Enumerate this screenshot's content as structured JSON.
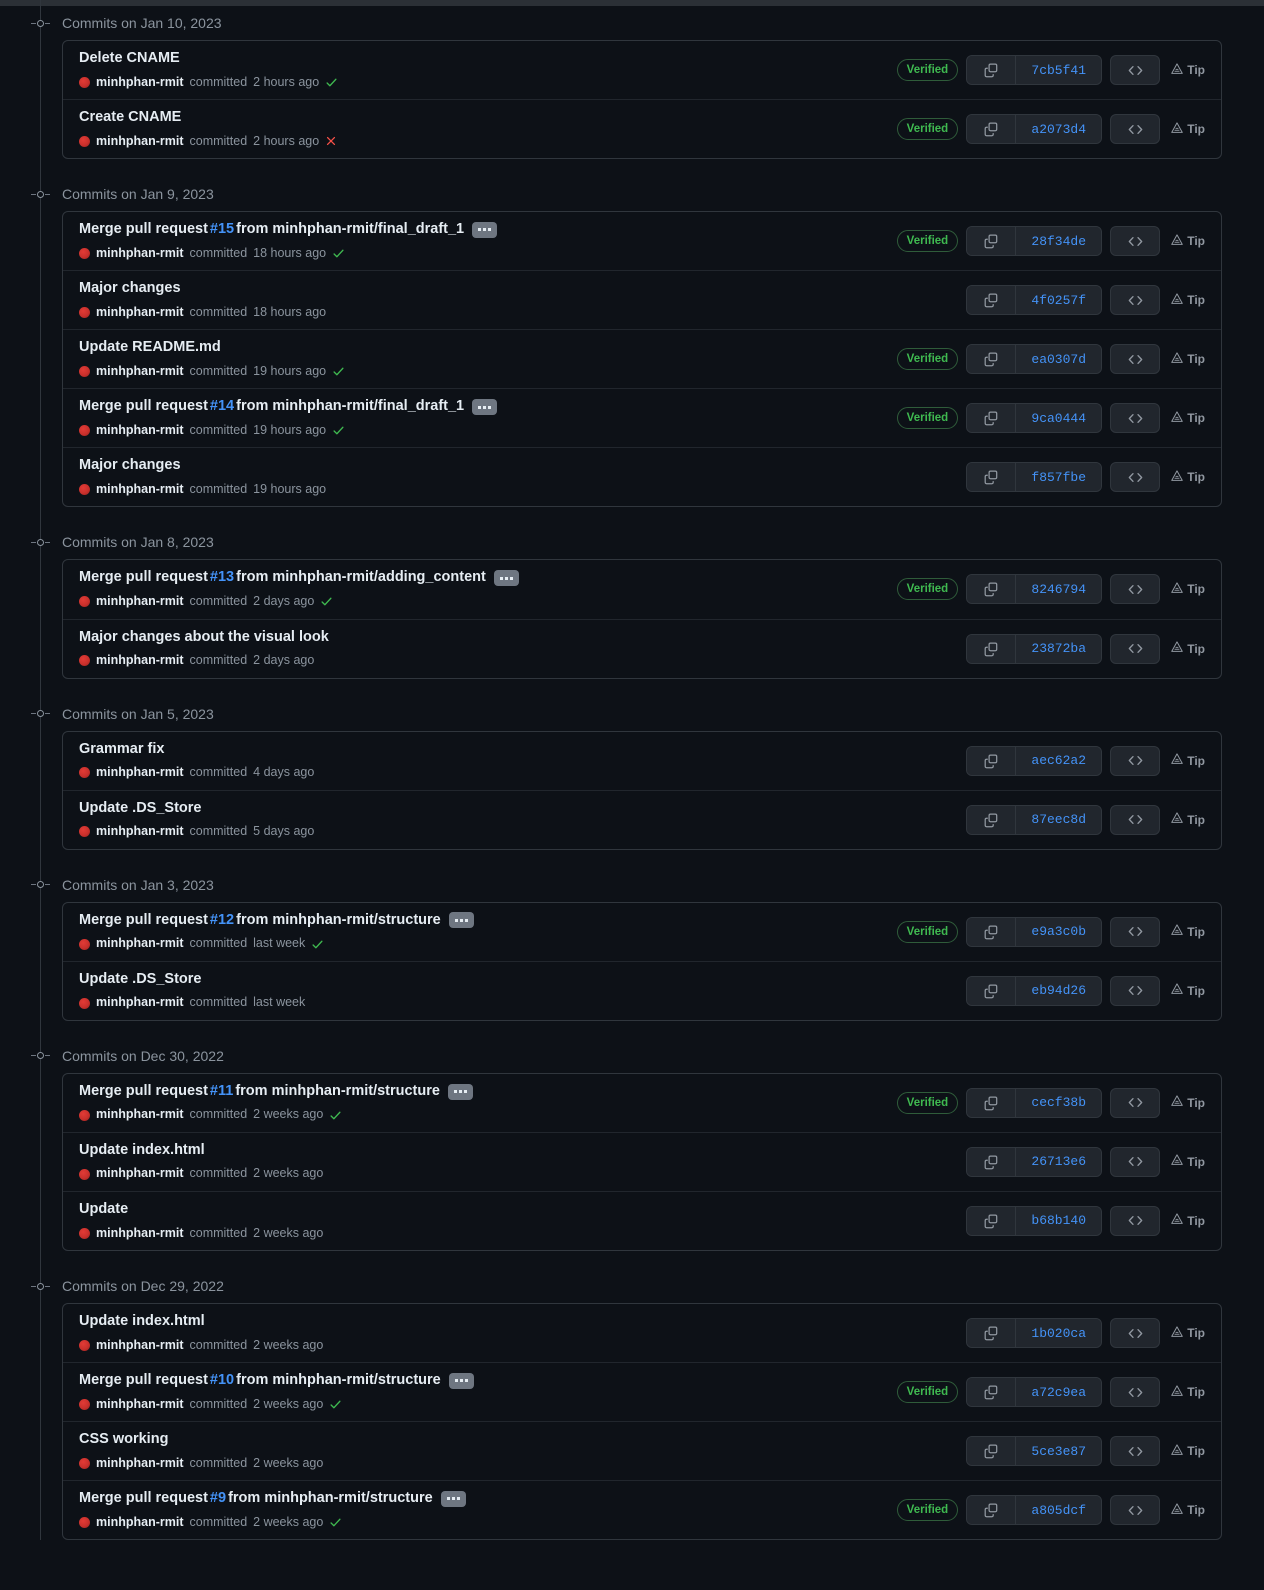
{
  "labels": {
    "verified": "Verified",
    "tip": "Tip",
    "committed": "committed",
    "expand_aria": "…"
  },
  "icons": {
    "copy": "copy-icon",
    "code": "code-icon",
    "tag": "tag-icon",
    "check": "check-icon",
    "cross": "cross-icon",
    "timeline_node": "timeline-node-icon",
    "avatar": "avatar-image"
  },
  "colors": {
    "background": "#0d1117",
    "border": "#30363d",
    "row_divider": "#21262d",
    "link": "#4493f8",
    "verified_green": "#3fb950",
    "failed_red": "#f85149",
    "muted_text": "#8b949e",
    "primary_text": "#e6edf3",
    "button_bg": "#21262d"
  },
  "author": "minhphan-rmit",
  "groups": [
    {
      "date": "Commits on Jan 10, 2023",
      "commits": [
        {
          "title_pre": "Delete CNAME",
          "pr": "",
          "title_post": "",
          "expander": false,
          "when": "2 hours ago",
          "signature": "check",
          "verified": "Verified",
          "sha": "7cb5f41"
        },
        {
          "title_pre": "Create CNAME",
          "pr": "",
          "title_post": "",
          "expander": false,
          "when": "2 hours ago",
          "signature": "cross",
          "verified": "Verified",
          "sha": "a2073d4"
        }
      ]
    },
    {
      "date": "Commits on Jan 9, 2023",
      "commits": [
        {
          "title_pre": "Merge pull request ",
          "pr": "#15",
          "title_post": " from minhphan-rmit/final_draft_1",
          "expander": true,
          "when": "18 hours ago",
          "signature": "check",
          "verified": "Verified",
          "sha": "28f34de"
        },
        {
          "title_pre": "Major changes",
          "pr": "",
          "title_post": "",
          "expander": false,
          "when": "18 hours ago",
          "signature": "none",
          "verified": "",
          "sha": "4f0257f"
        },
        {
          "title_pre": "Update README.md",
          "pr": "",
          "title_post": "",
          "expander": false,
          "when": "19 hours ago",
          "signature": "check",
          "verified": "Verified",
          "sha": "ea0307d"
        },
        {
          "title_pre": "Merge pull request ",
          "pr": "#14",
          "title_post": " from minhphan-rmit/final_draft_1",
          "expander": true,
          "when": "19 hours ago",
          "signature": "check",
          "verified": "Verified",
          "sha": "9ca0444"
        },
        {
          "title_pre": "Major changes",
          "pr": "",
          "title_post": "",
          "expander": false,
          "when": "19 hours ago",
          "signature": "none",
          "verified": "",
          "sha": "f857fbe"
        }
      ]
    },
    {
      "date": "Commits on Jan 8, 2023",
      "commits": [
        {
          "title_pre": "Merge pull request ",
          "pr": "#13",
          "title_post": " from minhphan-rmit/adding_content",
          "expander": true,
          "when": "2 days ago",
          "signature": "check",
          "verified": "Verified",
          "sha": "8246794"
        },
        {
          "title_pre": "Major changes about the visual look",
          "pr": "",
          "title_post": "",
          "expander": false,
          "when": "2 days ago",
          "signature": "none",
          "verified": "",
          "sha": "23872ba"
        }
      ]
    },
    {
      "date": "Commits on Jan 5, 2023",
      "commits": [
        {
          "title_pre": "Grammar fix",
          "pr": "",
          "title_post": "",
          "expander": false,
          "when": "4 days ago",
          "signature": "none",
          "verified": "",
          "sha": "aec62a2"
        },
        {
          "title_pre": "Update .DS_Store",
          "pr": "",
          "title_post": "",
          "expander": false,
          "when": "5 days ago",
          "signature": "none",
          "verified": "",
          "sha": "87eec8d"
        }
      ]
    },
    {
      "date": "Commits on Jan 3, 2023",
      "commits": [
        {
          "title_pre": "Merge pull request ",
          "pr": "#12",
          "title_post": " from minhphan-rmit/structure",
          "expander": true,
          "when": "last week",
          "signature": "check",
          "verified": "Verified",
          "sha": "e9a3c0b"
        },
        {
          "title_pre": "Update .DS_Store",
          "pr": "",
          "title_post": "",
          "expander": false,
          "when": "last week",
          "signature": "none",
          "verified": "",
          "sha": "eb94d26"
        }
      ]
    },
    {
      "date": "Commits on Dec 30, 2022",
      "commits": [
        {
          "title_pre": "Merge pull request ",
          "pr": "#11",
          "title_post": " from minhphan-rmit/structure",
          "expander": true,
          "when": "2 weeks ago",
          "signature": "check",
          "verified": "Verified",
          "sha": "cecf38b"
        },
        {
          "title_pre": "Update index.html",
          "pr": "",
          "title_post": "",
          "expander": false,
          "when": "2 weeks ago",
          "signature": "none",
          "verified": "",
          "sha": "26713e6"
        },
        {
          "title_pre": "Update",
          "pr": "",
          "title_post": "",
          "expander": false,
          "when": "2 weeks ago",
          "signature": "none",
          "verified": "",
          "sha": "b68b140"
        }
      ]
    },
    {
      "date": "Commits on Dec 29, 2022",
      "commits": [
        {
          "title_pre": "Update index.html",
          "pr": "",
          "title_post": "",
          "expander": false,
          "when": "2 weeks ago",
          "signature": "none",
          "verified": "",
          "sha": "1b020ca"
        },
        {
          "title_pre": "Merge pull request ",
          "pr": "#10",
          "title_post": " from minhphan-rmit/structure",
          "expander": true,
          "when": "2 weeks ago",
          "signature": "check",
          "verified": "Verified",
          "sha": "a72c9ea"
        },
        {
          "title_pre": "CSS working",
          "pr": "",
          "title_post": "",
          "expander": false,
          "when": "2 weeks ago",
          "signature": "none",
          "verified": "",
          "sha": "5ce3e87"
        },
        {
          "title_pre": "Merge pull request ",
          "pr": "#9",
          "title_post": " from minhphan-rmit/structure",
          "expander": true,
          "when": "2 weeks ago",
          "signature": "check",
          "verified": "Verified",
          "sha": "a805dcf"
        }
      ]
    }
  ]
}
